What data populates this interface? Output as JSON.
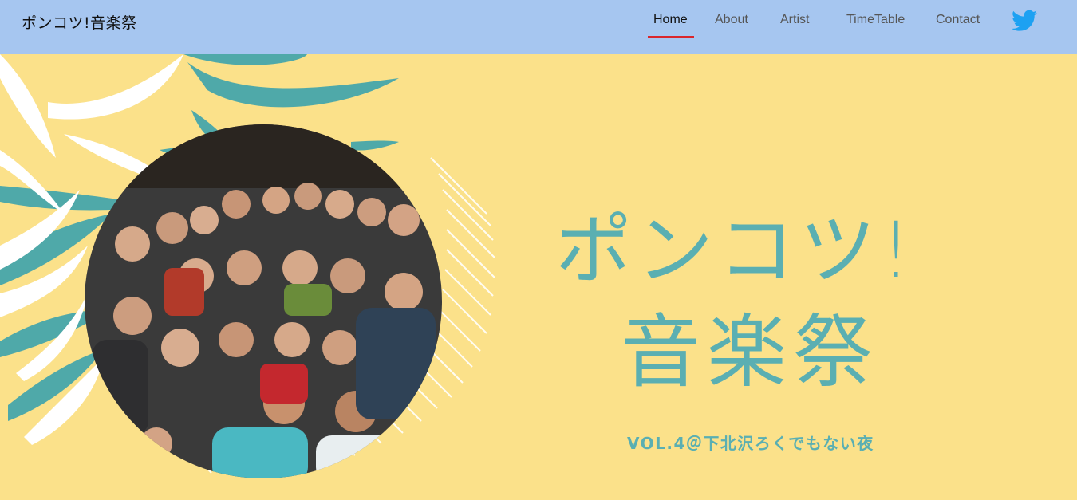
{
  "header": {
    "logo": "ポンコツ!音楽祭",
    "nav": [
      {
        "label": "Home",
        "active": true
      },
      {
        "label": "About",
        "active": false
      },
      {
        "label": "Artist",
        "active": false
      },
      {
        "label": "TimeTable",
        "active": false
      },
      {
        "label": "Contact",
        "active": false
      }
    ],
    "social_icon": "twitter-icon"
  },
  "hero": {
    "title_line1": "ポンコツ!",
    "title_line2": "音楽祭",
    "subtitle": "VOL.4＠下北沢ろくでもない夜",
    "photo_alt": "crowd-group-photo"
  },
  "colors": {
    "header_bg": "#a6c6f0",
    "page_bg": "#fbe18a",
    "accent_teal": "#5aafb2",
    "active_underline": "#d9262c",
    "twitter_blue": "#1da1f2"
  }
}
